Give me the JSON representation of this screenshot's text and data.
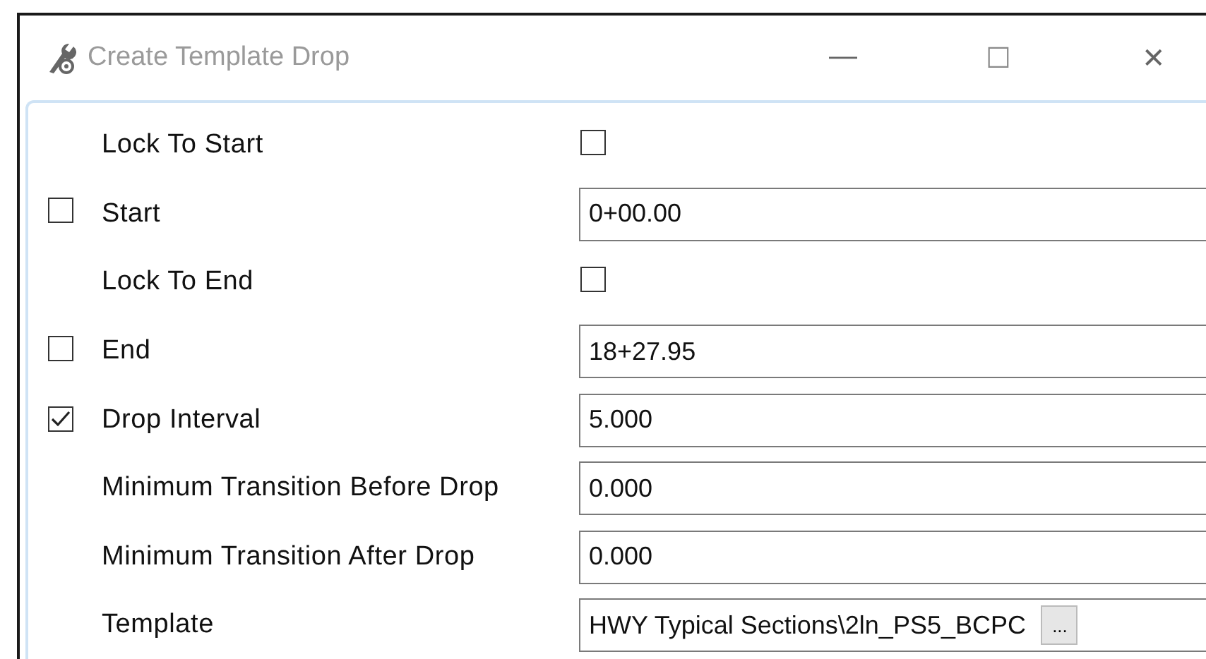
{
  "window": {
    "title": "Create Template Drop",
    "controls": [
      "—",
      "☐",
      "✕"
    ]
  },
  "rows": [
    {
      "kind": "checkbox",
      "label": "Lock To Start",
      "checked": false
    },
    {
      "kind": "field",
      "label": "Start",
      "value": "0+00.00",
      "enable": {
        "checked": false
      }
    },
    {
      "kind": "checkbox",
      "label": "Lock To End",
      "checked": false
    },
    {
      "kind": "field",
      "label": "End",
      "value": "18+27.95",
      "enable": {
        "checked": false
      }
    },
    {
      "kind": "field",
      "label": "Drop Interval",
      "value": "5.000",
      "enable": {
        "checked": true
      }
    },
    {
      "kind": "field",
      "label": "Minimum Transition Before Drop",
      "value": "0.000"
    },
    {
      "kind": "field",
      "label": "Minimum Transition After Drop",
      "value": "0.000"
    },
    {
      "kind": "field",
      "label": "Template",
      "value": "HWY Typical Sections\\2ln_PS5_BCPC",
      "browse": "..."
    }
  ]
}
